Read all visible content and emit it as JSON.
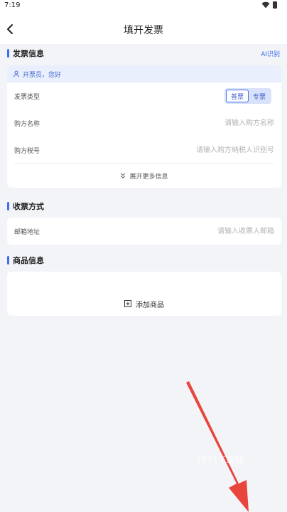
{
  "status_bar": {
    "time": "7:19"
  },
  "nav": {
    "title": "填开发票"
  },
  "invoice_section": {
    "title": "发票信息",
    "ai_link": "AI识别",
    "greeting": "开票员，您好",
    "type_label": "发票类型",
    "type_options": [
      "普票",
      "专票"
    ],
    "buyer_name_label": "购方名称",
    "buyer_name_placeholder": "请输入购方名称",
    "buyer_tax_label": "购方税号",
    "buyer_tax_placeholder": "请输入购方纳税人识别号",
    "expand_label": "展开更多信息"
  },
  "delivery_section": {
    "title": "收票方式",
    "email_label": "邮箱地址",
    "email_placeholder": "请输入收票人邮箱"
  },
  "goods_section": {
    "title": "商品信息",
    "add_label": "添加商品"
  },
  "overlay": {
    "watermark": "7871下载站"
  },
  "colors": {
    "accent": "#3d6ff0",
    "arrow": "#e8453c",
    "background": "#f3f4f8"
  }
}
